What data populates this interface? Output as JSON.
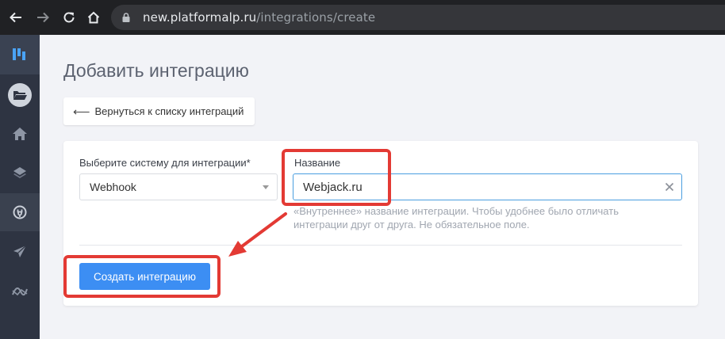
{
  "browser": {
    "url_host": "new.platformalp.ru",
    "url_path": "/integrations/create"
  },
  "sidebar": {
    "items": [
      {
        "icon": "logo-icon"
      },
      {
        "icon": "folder-icon"
      },
      {
        "icon": "home-icon"
      },
      {
        "icon": "layers-icon"
      },
      {
        "icon": "integrations-icon",
        "active": true
      },
      {
        "icon": "send-icon"
      },
      {
        "icon": "analytics-icon"
      }
    ]
  },
  "page": {
    "title": "Добавить интеграцию",
    "back_label": "Вернуться к списку интеграций"
  },
  "form": {
    "system_label": "Выберите систему для интеграции*",
    "system_value": "Webhook",
    "name_label": "Название",
    "name_value": "Webjack.ru",
    "name_hint": "«Внутреннее» название интеграции. Чтобы удобнее было отличать интеграции друг от друга. Не обязательное поле.",
    "submit_label": "Создать интеграцию"
  },
  "colors": {
    "accent": "#3c8ef3",
    "annotation": "#e33a34",
    "sidebar_bg": "#2e3442"
  }
}
